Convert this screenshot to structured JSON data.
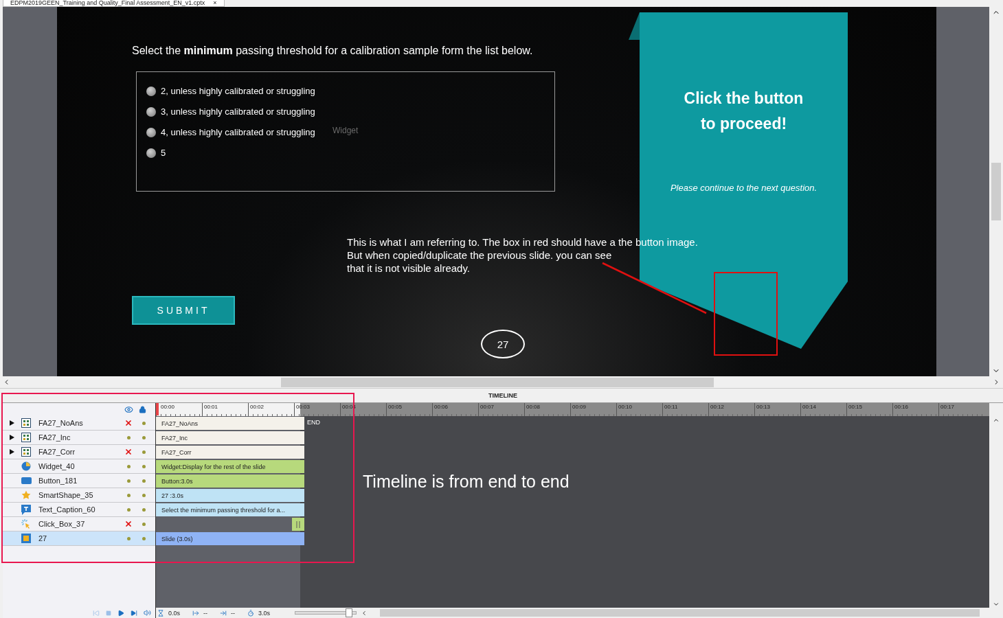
{
  "document_tab": {
    "title": "EDPM2019GEEN_Training and Quality_Final Assessment_EN_v1.cptx",
    "close": "×"
  },
  "slide": {
    "question": "Select the **minimum** passing threshold for a calibration sample form the list below.",
    "options": [
      {
        "label": "2, unless highly calibrated or struggling",
        "selected": false
      },
      {
        "label": "3, unless highly calibrated or struggling",
        "selected": false
      },
      {
        "label": "4, unless highly calibrated or struggling",
        "selected": false
      },
      {
        "label": "5",
        "selected": false
      }
    ],
    "ghost_label": "Widget",
    "submit": "SUBMIT",
    "slide_number": "27",
    "banner": {
      "title": "Click the button",
      "title_2": "to proceed!",
      "subtitle": "Please continue to the next question."
    },
    "note": [
      "This is what I am referring to. The box in red should have a the button image.",
      "But when copied/duplicate the previous slide. you can see",
      "that it is not visible already."
    ]
  },
  "timeline": {
    "title": "TIMELINE",
    "ruler": [
      "00:00",
      "00:01",
      "00:02",
      "00:03",
      "00:04",
      "00:05",
      "00:06",
      "00:07",
      "00:08",
      "00:09",
      "00:10",
      "00:11",
      "00:12",
      "00:13",
      "00:14",
      "00:15",
      "00:16",
      "00:17"
    ],
    "end_label": "END",
    "layers": [
      {
        "name": "FA27_NoAns",
        "kind": "group",
        "expanded": false,
        "visible": false,
        "selected": false,
        "bar": "FA27_NoAns"
      },
      {
        "name": "FA27_Inc",
        "kind": "group",
        "expanded": false,
        "visible": true,
        "selected": false,
        "bar": "FA27_Inc"
      },
      {
        "name": "FA27_Corr",
        "kind": "group",
        "expanded": false,
        "visible": false,
        "selected": false,
        "bar": "FA27_Corr"
      },
      {
        "name": "Widget_40",
        "kind": "widget",
        "visible": true,
        "selected": false,
        "bar": "Widget:Display for the rest of the slide"
      },
      {
        "name": "Button_181",
        "kind": "button",
        "visible": true,
        "selected": false,
        "bar": "Button:3.0s"
      },
      {
        "name": "SmartShape_35",
        "kind": "shape",
        "visible": true,
        "selected": false,
        "bar": "27 :3.0s"
      },
      {
        "name": "Text_Caption_60",
        "kind": "caption",
        "visible": true,
        "selected": false,
        "bar": "Select the minimum passing threshold for a..."
      },
      {
        "name": "Click_Box_37",
        "kind": "clickbox",
        "visible": false,
        "selected": false
      },
      {
        "name": "27",
        "kind": "slide",
        "visible": true,
        "selected": true,
        "bar": "Slide (3.0s)"
      }
    ],
    "annotation": "Timeline is from end to end",
    "toolbar": {
      "current_time": "0.0s",
      "start": "--",
      "end": "--",
      "duration": "3.0s",
      "zoom": {
        "level": 0.88
      }
    }
  }
}
